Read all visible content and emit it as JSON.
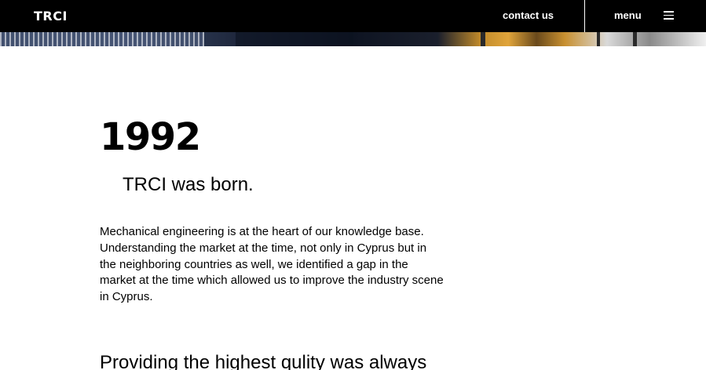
{
  "header": {
    "logo": "TRCI",
    "contact_label": "contact us",
    "menu_label": "menu",
    "menu_icon": "hamburger-icon",
    "background": "#000000",
    "text_color": "#ffffff"
  },
  "hero": {
    "image": "building-exterior-photo"
  },
  "main": {
    "year": "1992",
    "subtitle": "TRCI was born.",
    "paragraph": "Mechanical engineering is at the heart of our knowledge base. Understanding the market at the time, not only in Cyprus but in the neighboring countries as well, we identified a gap in the market at the time which allowed us to improve the industry scene in Cyprus.",
    "next_heading": "Providing the highest qulity was always"
  }
}
